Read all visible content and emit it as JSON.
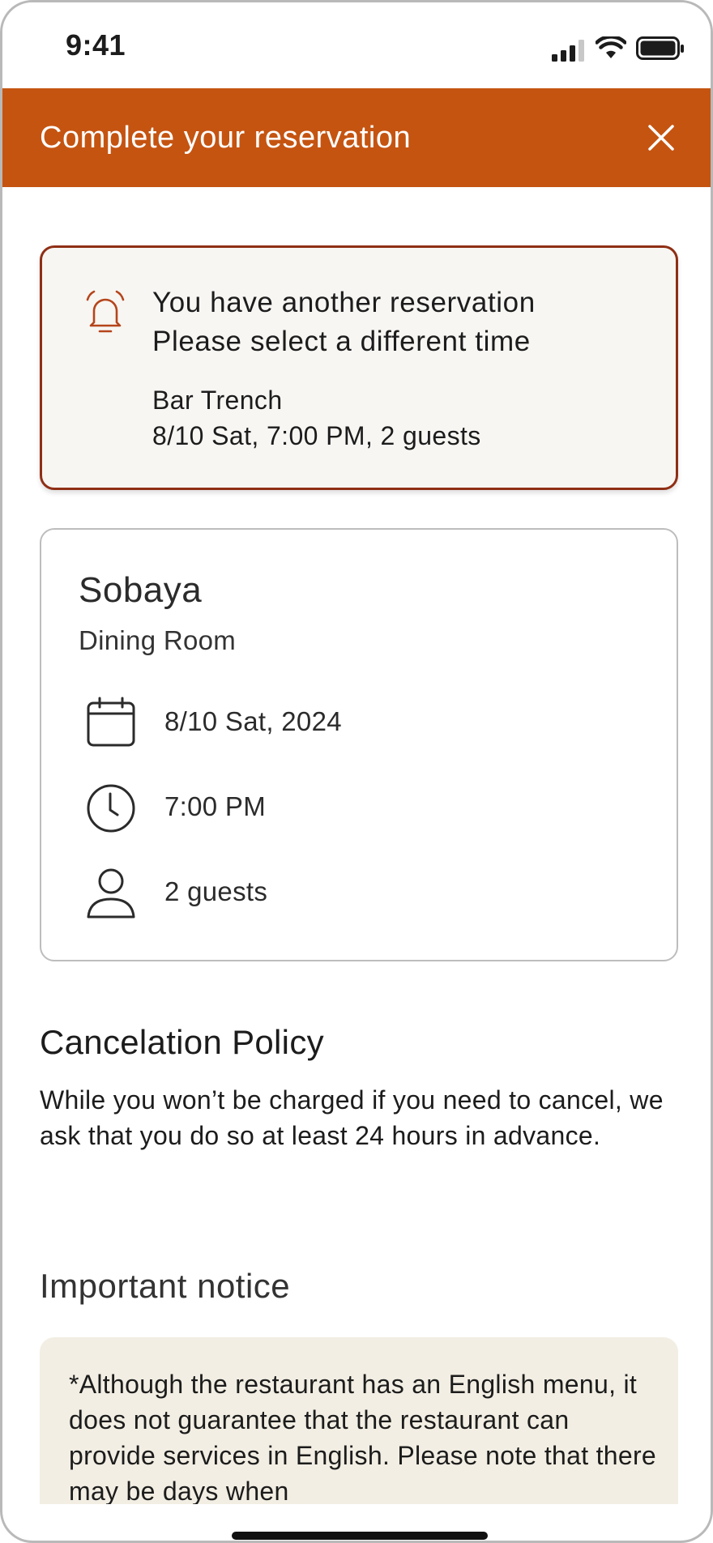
{
  "status_bar": {
    "time": "9:41",
    "icons": [
      "signal-icon",
      "wifi-icon",
      "battery-icon"
    ]
  },
  "header": {
    "title": "Complete your reservation",
    "close_icon": "close-icon",
    "background_color": "#c55411"
  },
  "alert": {
    "icon": "bell-alarm-icon",
    "line1": "You have another reservation",
    "line2": "Please select a different time",
    "detail_restaurant": "Bar Trench",
    "detail_when": "8/10 Sat, 7:00 PM, 2 guests",
    "border_color": "#8f2f15"
  },
  "reservation": {
    "restaurant": "Sobaya",
    "room": "Dining Room",
    "date": "8/10 Sat, 2024",
    "time": "7:00 PM",
    "guests": "2 guests"
  },
  "cancelation_policy": {
    "title": "Cancelation Policy",
    "text": "While you won’t be charged if you need to cancel, we ask that you do so at least 24 hours in advance."
  },
  "important_notice": {
    "title": "Important notice",
    "text": "*Although the restaurant has an English menu, it does not guarantee that the restaurant can provide services in English. Please note that there may be days when"
  }
}
